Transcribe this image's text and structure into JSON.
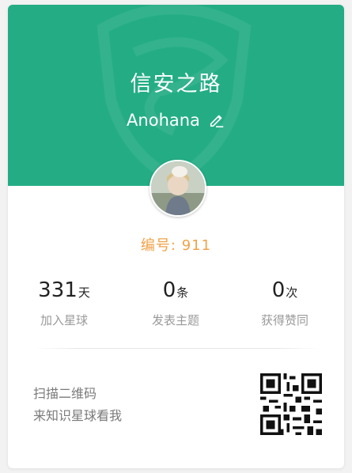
{
  "planet": {
    "name": "信安之路",
    "owner": "Anohana",
    "serial": "编号: 911"
  },
  "icons": {
    "edit": "pencil-edit-icon",
    "watermark": "shield-logo-icon",
    "qr": "qr-code-icon"
  },
  "stats": [
    {
      "value": "331",
      "unit": "天",
      "label": "加入星球"
    },
    {
      "value": "0",
      "unit": "条",
      "label": "发表主题"
    },
    {
      "value": "0",
      "unit": "次",
      "label": "获得赞同"
    }
  ],
  "qr": {
    "line1": "扫描二维码",
    "line2": "来知识星球看我"
  },
  "colors": {
    "header": "#24ad85",
    "serial": "#f0a248",
    "label": "#9a9a9a",
    "value": "#222222"
  }
}
